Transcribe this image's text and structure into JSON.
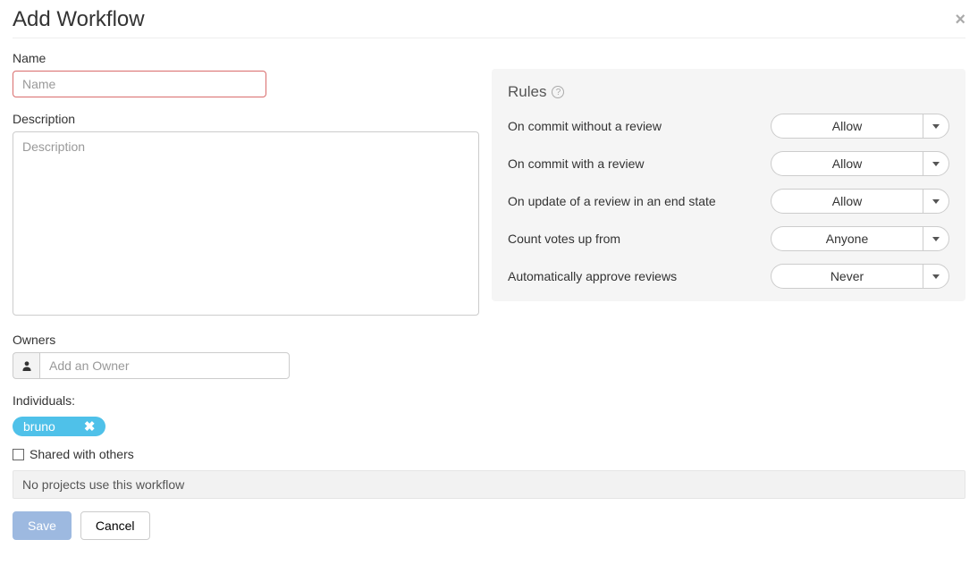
{
  "header": {
    "title": "Add Workflow"
  },
  "form": {
    "name_label": "Name",
    "name_placeholder": "Name",
    "name_value": "",
    "description_label": "Description",
    "description_placeholder": "Description",
    "description_value": "",
    "owners_label": "Owners",
    "owners_placeholder": "Add an Owner",
    "individuals_label": "Individuals:",
    "individual_chip": "bruno",
    "shared_label": "Shared with others",
    "shared_checked": false,
    "projects_message": "No projects use this workflow"
  },
  "rules": {
    "title": "Rules",
    "items": [
      {
        "label": "On commit without a review",
        "value": "Allow"
      },
      {
        "label": "On commit with a review",
        "value": "Allow"
      },
      {
        "label": "On update of a review in an end state",
        "value": "Allow"
      },
      {
        "label": "Count votes up from",
        "value": "Anyone"
      },
      {
        "label": "Automatically approve reviews",
        "value": "Never"
      }
    ]
  },
  "footer": {
    "save": "Save",
    "cancel": "Cancel"
  }
}
